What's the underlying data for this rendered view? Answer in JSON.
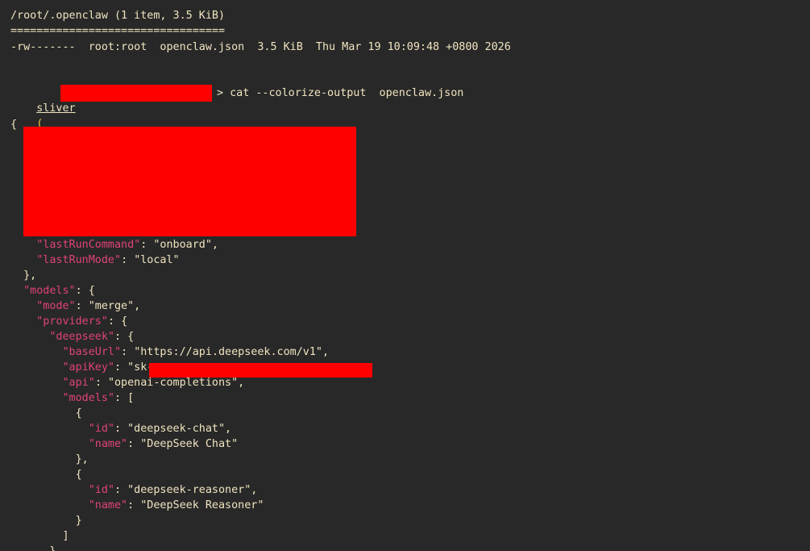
{
  "listing": {
    "header": "/root/.openclaw (1 item, 3.5 KiB)",
    "separator": "=================================",
    "row": "-rw-------  root:root  openclaw.json  3.5 KiB  Thu Mar 19 10:09:48 +0800 2026"
  },
  "prompt": {
    "user": "sliver",
    "open_paren": "(",
    "command": "> cat --colorize-output  openclaw.json"
  },
  "json": {
    "open_brace": "{",
    "lines": [
      {
        "indent": "    ",
        "key": "\"lastRunCommand\"",
        "sep": ": ",
        "value": "\"onboard\"",
        "end": ","
      },
      {
        "indent": "    ",
        "key": "\"lastRunMode\"",
        "sep": ": ",
        "value": "\"local\"",
        "end": ""
      },
      {
        "indent": "  ",
        "key": "",
        "sep": "",
        "value": "},",
        "end": ""
      },
      {
        "indent": "  ",
        "key": "\"models\"",
        "sep": ": ",
        "value": "{",
        "end": ""
      },
      {
        "indent": "    ",
        "key": "\"mode\"",
        "sep": ": ",
        "value": "\"merge\"",
        "end": ","
      },
      {
        "indent": "    ",
        "key": "\"providers\"",
        "sep": ": ",
        "value": "{",
        "end": ""
      },
      {
        "indent": "      ",
        "key": "\"deepseek\"",
        "sep": ": ",
        "value": "{",
        "end": ""
      },
      {
        "indent": "        ",
        "key": "\"baseUrl\"",
        "sep": ": ",
        "value": "\"https://api.deepseek.com/v1\"",
        "end": ","
      },
      {
        "indent": "        ",
        "key": "\"apiKey\"",
        "sep": ": ",
        "value": "\"sk-",
        "end": ""
      },
      {
        "indent": "        ",
        "key": "\"api\"",
        "sep": ": ",
        "value": "\"openai-completions\"",
        "end": ","
      },
      {
        "indent": "        ",
        "key": "\"models\"",
        "sep": ": ",
        "value": "[",
        "end": ""
      },
      {
        "indent": "          ",
        "key": "",
        "sep": "",
        "value": "{",
        "end": ""
      },
      {
        "indent": "            ",
        "key": "\"id\"",
        "sep": ": ",
        "value": "\"deepseek-chat\"",
        "end": ","
      },
      {
        "indent": "            ",
        "key": "\"name\"",
        "sep": ": ",
        "value": "\"DeepSeek Chat\"",
        "end": ""
      },
      {
        "indent": "          ",
        "key": "",
        "sep": "",
        "value": "},",
        "end": ""
      },
      {
        "indent": "          ",
        "key": "",
        "sep": "",
        "value": "{",
        "end": ""
      },
      {
        "indent": "            ",
        "key": "\"id\"",
        "sep": ": ",
        "value": "\"deepseek-reasoner\"",
        "end": ","
      },
      {
        "indent": "            ",
        "key": "\"name\"",
        "sep": ": ",
        "value": "\"DeepSeek Reasoner\"",
        "end": ""
      },
      {
        "indent": "          ",
        "key": "",
        "sep": "",
        "value": "}",
        "end": ""
      },
      {
        "indent": "        ",
        "key": "",
        "sep": "",
        "value": "]",
        "end": ""
      },
      {
        "indent": "      ",
        "key": "",
        "sep": "",
        "value": "},",
        "end": ""
      }
    ]
  },
  "colors": {
    "background": "#282828",
    "key": "#e0437a",
    "text": "#f0e4c0",
    "redaction": "#ff0000"
  }
}
